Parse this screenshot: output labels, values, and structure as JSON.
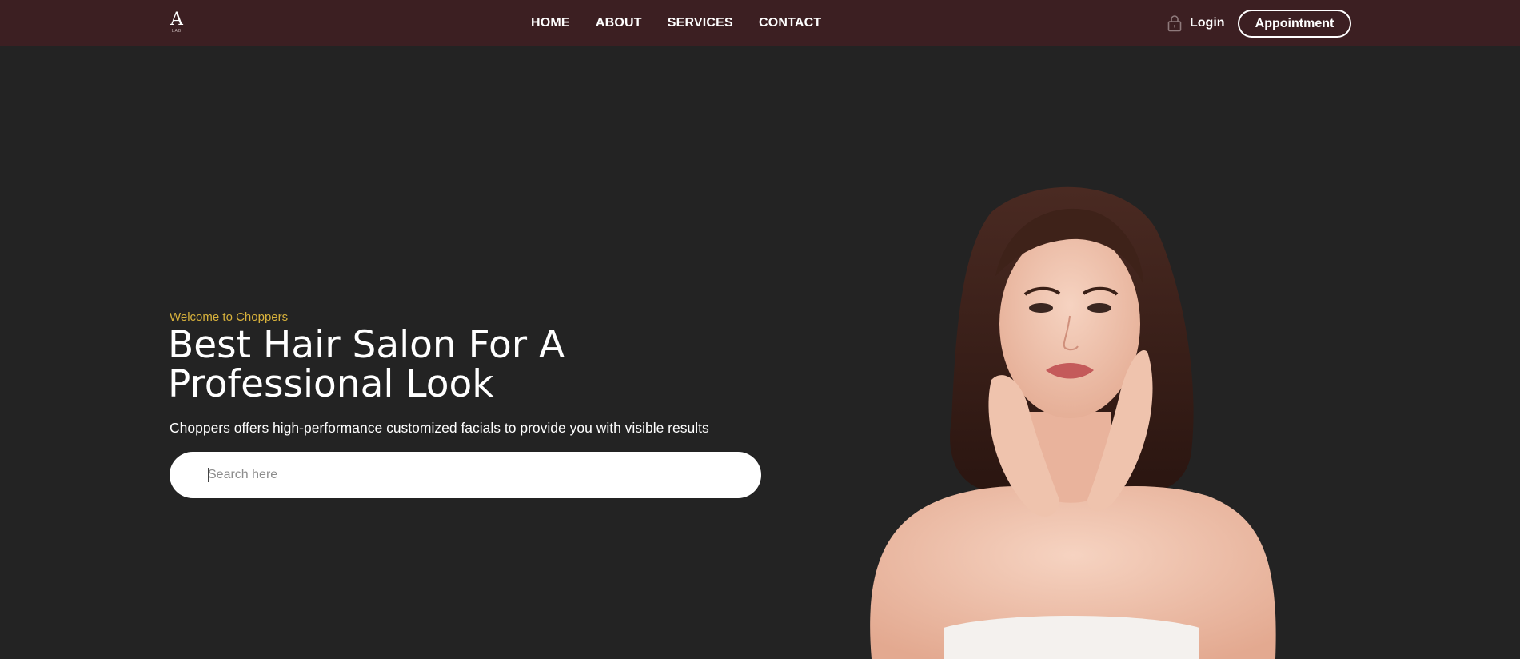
{
  "header": {
    "logo_letter": "A",
    "logo_sub": "LAB",
    "nav": [
      {
        "label": "HOME"
      },
      {
        "label": "ABOUT"
      },
      {
        "label": "SERVICES"
      },
      {
        "label": "CONTACT"
      }
    ],
    "login_label": "Login",
    "appointment_label": "Appointment"
  },
  "hero": {
    "eyebrow": "Welcome to Choppers",
    "headline_line1": "Best Hair Salon For A",
    "headline_line2": "Professional Look",
    "subtext": "Choppers offers high-performance customized facials to provide you with visible results",
    "search": {
      "placeholder": "Search here",
      "value": ""
    },
    "image_alt": "woman-portrait"
  },
  "colors": {
    "background": "#232323",
    "navbar": "#3c1f22",
    "accent": "#d8b23c",
    "text": "#ffffff"
  }
}
